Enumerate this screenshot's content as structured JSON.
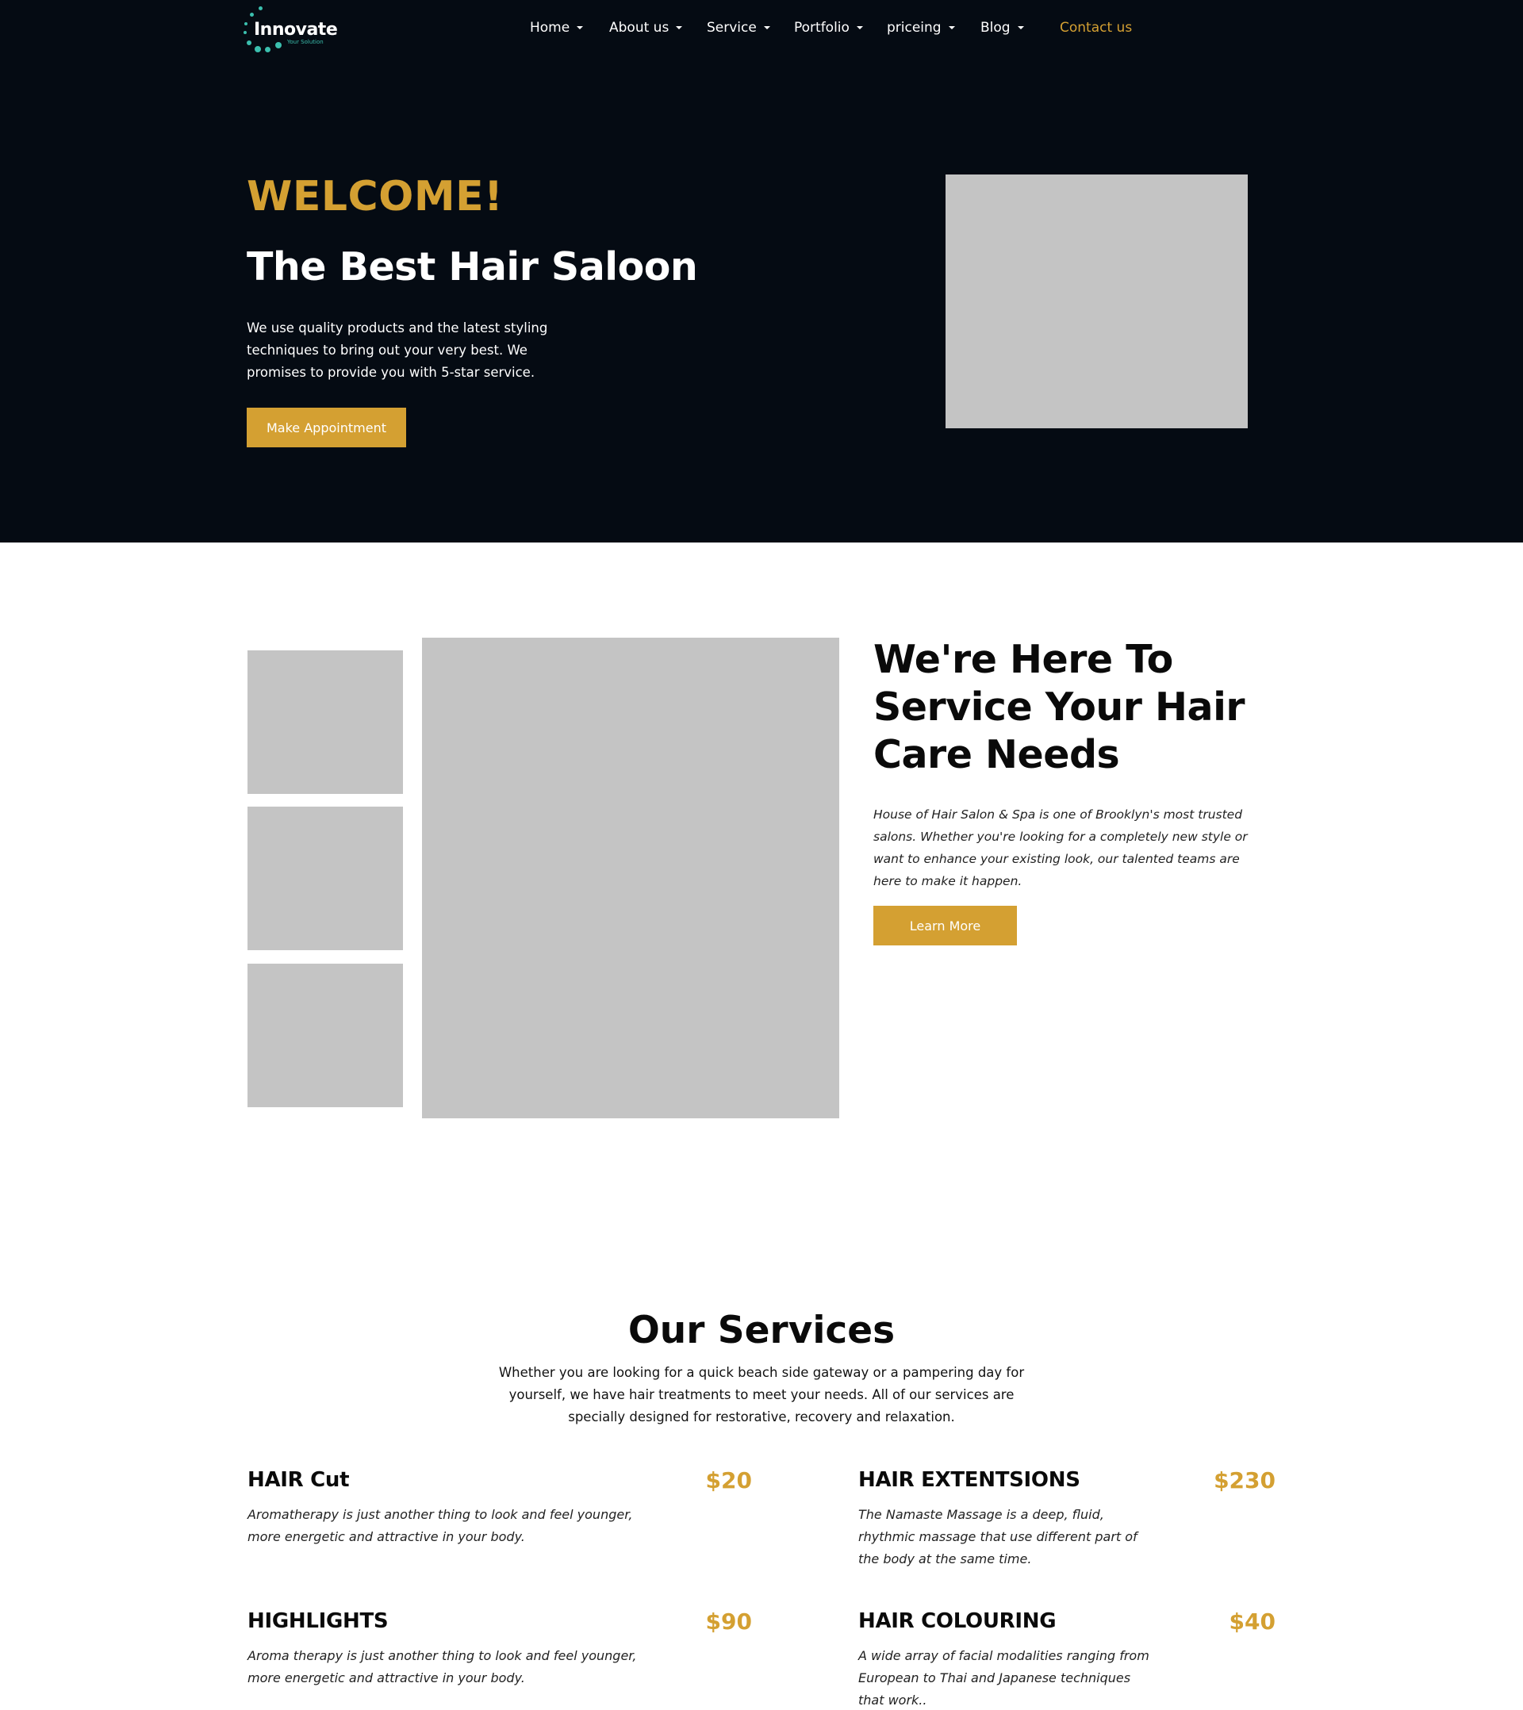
{
  "brand": {
    "name": "Innovate",
    "tagline": "Your Solution",
    "accent": "#3bbfae"
  },
  "colors": {
    "gold": "#d4a032",
    "dark": "#050b13",
    "placeholder": "#c4c4c4"
  },
  "nav": {
    "items": [
      {
        "label": "Home",
        "has_dropdown": true
      },
      {
        "label": "About us",
        "has_dropdown": true
      },
      {
        "label": "Service",
        "has_dropdown": true
      },
      {
        "label": "Portfolio",
        "has_dropdown": true
      },
      {
        "label": "priceing",
        "has_dropdown": true
      },
      {
        "label": "Blog",
        "has_dropdown": true
      }
    ],
    "contact": "Contact us"
  },
  "hero": {
    "welcome": "WELCOME!",
    "title": "The Best Hair Saloon",
    "text": "We use quality products and the latest styling techniques to bring out your very best. We promises to provide you with 5-star service.",
    "button": "Make Appointment"
  },
  "about": {
    "title": "We're Here To Service Your Hair Care Needs",
    "text": "House of Hair Salon & Spa is one of Brooklyn's most trusted salons. Whether you're looking for a completely new style or want to enhance your existing look, our talented teams are here to make it happen.",
    "button": "Learn More"
  },
  "services": {
    "title": "Our Services",
    "intro": "Whether you are looking for a quick beach side gateway or a pampering day for yourself, we have hair treatments to meet your needs. All of our services are specially designed for restorative, recovery and relaxation.",
    "items": [
      {
        "name": "HAIR Cut",
        "price": "$20",
        "desc": "Aromatherapy is just another thing to look and feel younger, more energetic and attractive in your body."
      },
      {
        "name": "HAIR EXTENTSIONS",
        "price": "$230",
        "desc": "The Namaste Massage is a deep, fluid, rhythmic massage that use different part of the body at the same time."
      },
      {
        "name": "HIGHLIGHTS",
        "price": "$90",
        "desc": "Aroma therapy is just another thing to look and feel younger, more energetic and attractive in your body."
      },
      {
        "name": "HAIR COLOURING",
        "price": "$40",
        "desc": "A wide array of facial modalities ranging from European to Thai and Japanese techniques that work.."
      }
    ]
  }
}
